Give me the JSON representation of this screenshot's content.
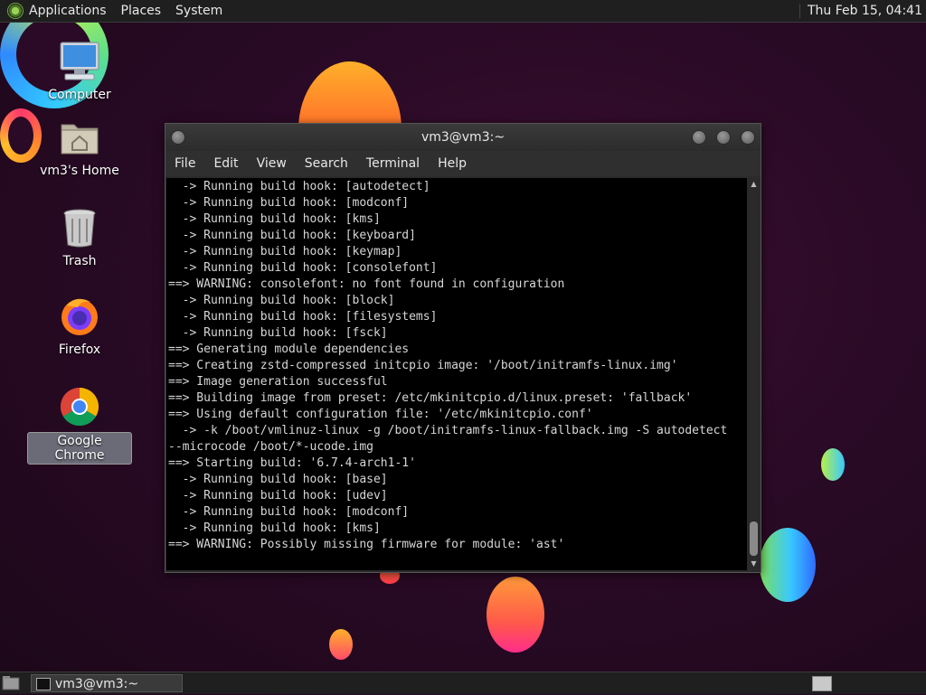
{
  "top_panel": {
    "menus": [
      "Applications",
      "Places",
      "System"
    ],
    "clock": "Thu Feb 15, 04:41"
  },
  "desktop": {
    "icons": [
      {
        "label": "Computer"
      },
      {
        "label": "vm3's Home"
      },
      {
        "label": "Trash"
      },
      {
        "label": "Firefox"
      },
      {
        "label": "Google Chrome"
      }
    ]
  },
  "terminal": {
    "title": "vm3@vm3:~",
    "menus": [
      "File",
      "Edit",
      "View",
      "Search",
      "Terminal",
      "Help"
    ],
    "lines": [
      "  -> Running build hook: [autodetect]",
      "  -> Running build hook: [modconf]",
      "  -> Running build hook: [kms]",
      "  -> Running build hook: [keyboard]",
      "  -> Running build hook: [keymap]",
      "  -> Running build hook: [consolefont]",
      "==> WARNING: consolefont: no font found in configuration",
      "  -> Running build hook: [block]",
      "  -> Running build hook: [filesystems]",
      "  -> Running build hook: [fsck]",
      "==> Generating module dependencies",
      "==> Creating zstd-compressed initcpio image: '/boot/initramfs-linux.img'",
      "==> Image generation successful",
      "==> Building image from preset: /etc/mkinitcpio.d/linux.preset: 'fallback'",
      "==> Using default configuration file: '/etc/mkinitcpio.conf'",
      "  -> -k /boot/vmlinuz-linux -g /boot/initramfs-linux-fallback.img -S autodetect",
      "--microcode /boot/*-ucode.img",
      "==> Starting build: '6.7.4-arch1-1'",
      "  -> Running build hook: [base]",
      "  -> Running build hook: [udev]",
      "  -> Running build hook: [modconf]",
      "  -> Running build hook: [kms]",
      "==> WARNING: Possibly missing firmware for module: 'ast'"
    ]
  },
  "taskbar": {
    "tasks": [
      {
        "label": "vm3@vm3:~"
      }
    ]
  }
}
